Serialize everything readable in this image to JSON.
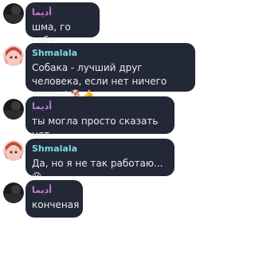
{
  "messages": [
    {
      "sender": "أديما",
      "text": "шма, го собз",
      "sender_color": "#c97ad8",
      "avatar": "dark-avatar"
    },
    {
      "sender": "Shmalala",
      "text": "Собака - лучший друг человека, если нет ничего лучше! 🐕👍",
      "sender_color": "#7fd8e8",
      "avatar": "anime-girl-avatar"
    },
    {
      "sender": "أديما",
      "text": "ты могла просто сказать нет",
      "sender_color": "#c97ad8",
      "avatar": "dark-avatar"
    },
    {
      "sender": "Shmalala",
      "text": "Да, но я не так работаю... 😜",
      "sender_color": "#7fd8e8",
      "avatar": "anime-girl-avatar"
    },
    {
      "sender": "أديما",
      "text": "конченая",
      "sender_color": "#c97ad8",
      "avatar": "dark-avatar"
    }
  ]
}
